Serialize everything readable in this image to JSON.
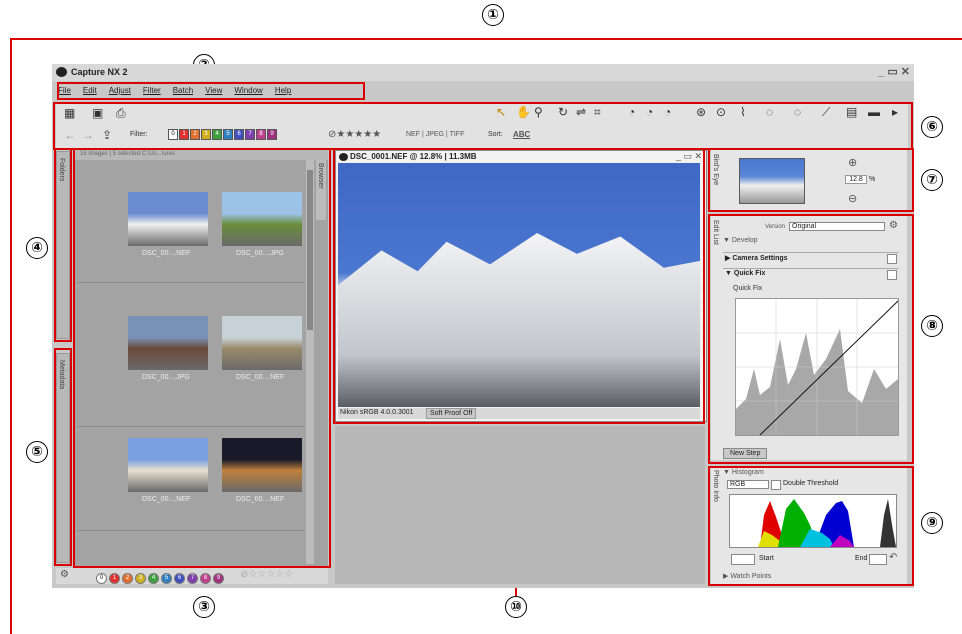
{
  "callouts": [
    "①",
    "②",
    "③",
    "④",
    "⑤",
    "⑥",
    "⑦",
    "⑧",
    "⑨",
    "⑩"
  ],
  "app": {
    "title": "Capture NX 2",
    "window_controls": "_ ▭ ✕",
    "menu": [
      "File",
      "Edit",
      "Adjust",
      "Filter",
      "Batch",
      "View",
      "Window",
      "Help"
    ]
  },
  "toolbar": {
    "filter_label": "Filter:",
    "label_filters": [
      "0",
      "1",
      "2",
      "3",
      "4",
      "5",
      "6",
      "7",
      "8",
      "9"
    ],
    "rating": "⊘★★★★★",
    "formats": "NEF | JPEG | TIFF",
    "sort_label": "Sort:",
    "sort_value": "ABC"
  },
  "browser": {
    "header": "16 images | 5 selected  C:\\Us...\\ures",
    "side_tabs": {
      "folders": "Folders",
      "metadata": "Metadata",
      "browser": "Browser"
    },
    "thumbs": [
      {
        "name": "DSC_00....NEF",
        "c1": "#f0f0f0",
        "c2": "#6a8cd0"
      },
      {
        "name": "DSC_00....JPG",
        "c1": "#6a8e3a",
        "c2": "#9cc2e8"
      },
      {
        "name": "DSC_00....JPG",
        "c1": "#6a4a3a",
        "c2": "#7a92b8"
      },
      {
        "name": "DSC_00....NEF",
        "c1": "#9a8a6a",
        "c2": "#c7d2d8"
      },
      {
        "name": "DSC_00....NEF",
        "c1": "#e8e0d0",
        "c2": "#7aa0e0"
      },
      {
        "name": "DSC_00....NEF",
        "c1": "#c0803a",
        "c2": "#1a1a2a"
      }
    ],
    "bottom_labels": [
      "0",
      "1",
      "2",
      "3",
      "4",
      "5",
      "6",
      "7",
      "8",
      "9"
    ],
    "bottom_stars": "⊘☆☆☆☆☆"
  },
  "editor": {
    "title": "DSC_0001.NEF @ 12.8% | 11.3MB",
    "status_profile": "Nikon sRGB 4.0.0.3001",
    "soft_proof": "Soft Proof Off"
  },
  "bird_eye": {
    "zoom": "12.8",
    "unit": "%",
    "tab": "Bird's Eye"
  },
  "edit_list": {
    "version_label": "Version",
    "version_value": "Original",
    "develop": "▼ Develop",
    "camera_settings": "▶ Camera Settings",
    "quick_fix": "▼ Quick Fix",
    "quick_fix_item": "Quick Fix",
    "new_step": "New Step",
    "tab": "Edit List"
  },
  "histogram_panel": {
    "title": "▼ Histogram",
    "channel": "RGB",
    "double_threshold": "Double Threshold",
    "start": "Start",
    "end": "End",
    "watch_points": "▶ Watch Points",
    "tab": "Photo Info"
  }
}
